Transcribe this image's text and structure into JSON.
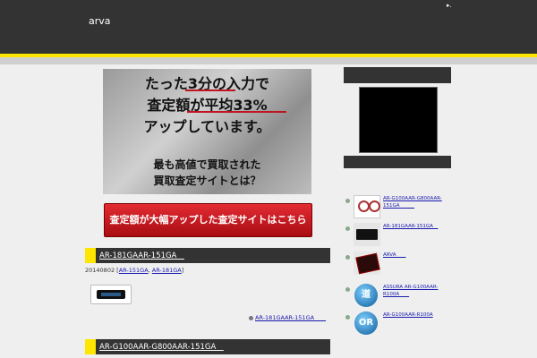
{
  "header": {
    "site_title": "arva",
    "corner_glyph": "▸."
  },
  "banner": {
    "line1": "たった3分の入力で",
    "line2": "査定額が平均33%",
    "line3": "アップしています。",
    "line4": "最も高値で買取された",
    "line5": "買取査定サイトとは？"
  },
  "cta": {
    "label": "査定額が大幅アップした査定サイトはこちら"
  },
  "posts": [
    {
      "title": "AR-181GAAR-151GA　",
      "date": "20140802",
      "tags": [
        "AR-151GA",
        "AR-181GA"
      ],
      "more_link": "AR-181GAAR-151GA　　"
    },
    {
      "title": "AR-G100AAR-G800AAR-151GA　"
    }
  ],
  "sidebar": {
    "related": [
      {
        "label": "AR-G100AAR-G800AAR-151GA　　　",
        "icon": "rings-icon"
      },
      {
        "label": "AR-181GAAR-151GA　",
        "icon": "device-icon"
      },
      {
        "label": "ARVA　　",
        "icon": "red-device-icon"
      },
      {
        "label": "ASSURA AR-G100AAR-R100A　　",
        "icon": "bubble-icon",
        "icon_text": "道"
      },
      {
        "label": "AR-G100AAR-R100A",
        "icon": "bubble-icon",
        "icon_text": "OR"
      }
    ]
  },
  "colors": {
    "accent": "#ffe600",
    "dark": "#333333",
    "cta": "#d4202a",
    "link": "#1a1ab0"
  }
}
